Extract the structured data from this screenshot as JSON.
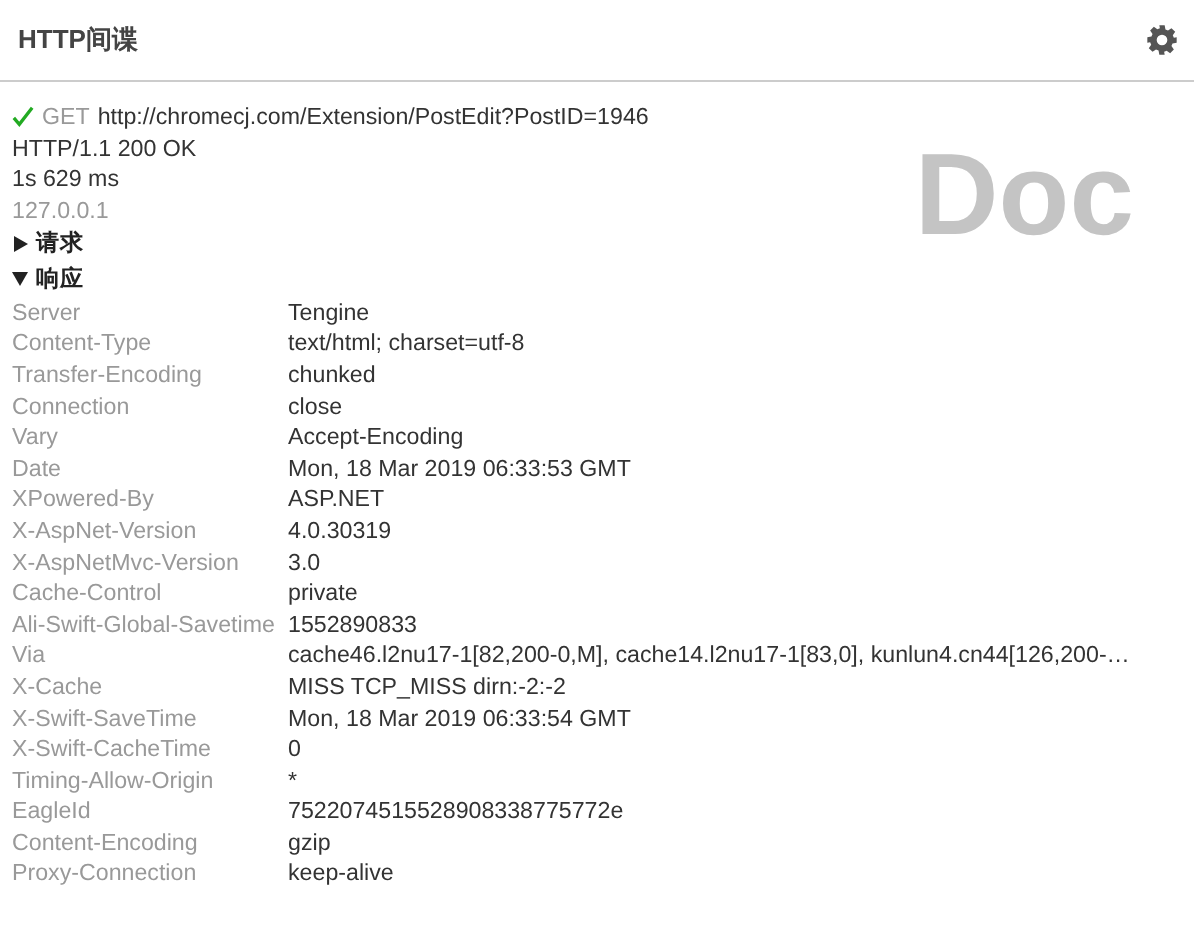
{
  "header": {
    "title": "HTTP间谍"
  },
  "request": {
    "succeeded": true,
    "method": "GET",
    "url": "http://chromecj.com/Extension/PostEdit?PostID=1946",
    "status": "HTTP/1.1 200 OK",
    "duration": "1s 629 ms",
    "ip": "127.0.0.1",
    "type_label": "Doc"
  },
  "sections": [
    {
      "title": "请求",
      "expanded": false
    },
    {
      "title": "响应",
      "expanded": true,
      "headers": [
        {
          "name": "Server",
          "value": "Tengine"
        },
        {
          "name": "Content-Type",
          "value": "text/html; charset=utf-8"
        },
        {
          "name": "Transfer-Encoding",
          "value": "chunked"
        },
        {
          "name": "Connection",
          "value": "close"
        },
        {
          "name": "Vary",
          "value": "Accept-Encoding"
        },
        {
          "name": "Date",
          "value": "Mon, 18 Mar 2019 06:33:53 GMT"
        },
        {
          "name": "XPowered-By",
          "value": "ASP.NET"
        },
        {
          "name": "X-AspNet-Version",
          "value": "4.0.30319"
        },
        {
          "name": "X-AspNetMvc-Version",
          "value": "3.0"
        },
        {
          "name": "Cache-Control",
          "value": "private"
        },
        {
          "name": "Ali-Swift-Global-Savetime",
          "value": "1552890833"
        },
        {
          "name": "Via",
          "value": "cache46.l2nu17-1[82,200-0,M], cache14.l2nu17-1[83,0], kunlun4.cn44[126,200-…"
        },
        {
          "name": "X-Cache",
          "value": "MISS TCP_MISS dirn:-2:-2"
        },
        {
          "name": "X-Swift-SaveTime",
          "value": "Mon, 18 Mar 2019 06:33:54 GMT"
        },
        {
          "name": "X-Swift-CacheTime",
          "value": "0"
        },
        {
          "name": "Timing-Allow-Origin",
          "value": "*"
        },
        {
          "name": "EagleId",
          "value": "7522074515528908338775772e"
        },
        {
          "name": "Content-Encoding",
          "value": "gzip"
        },
        {
          "name": "Proxy-Connection",
          "value": "keep-alive"
        }
      ]
    }
  ]
}
